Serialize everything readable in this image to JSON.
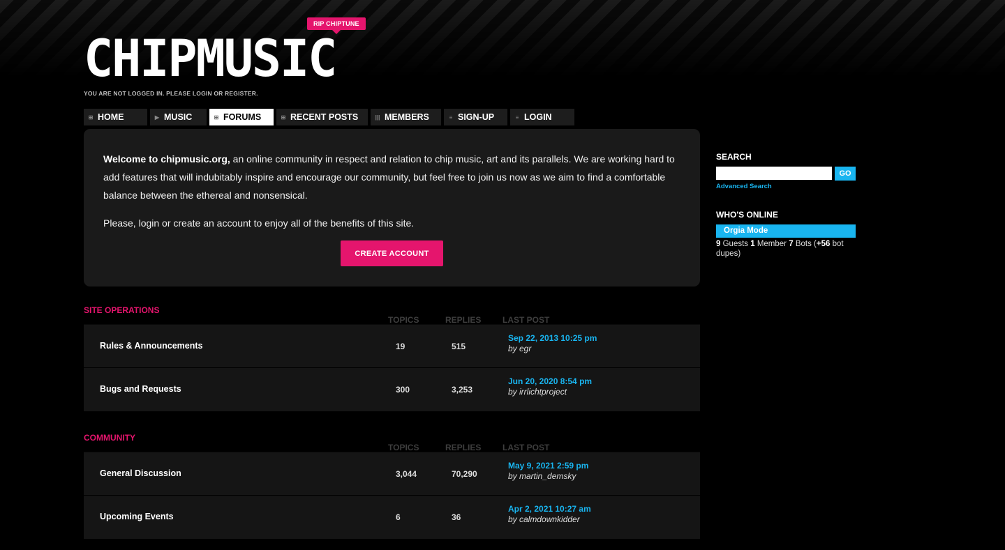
{
  "header": {
    "logo_text": "CHIPMUSIC",
    "rip_badge": "RIP CHIPTUNE",
    "login_note": "YOU ARE NOT LOGGED IN. PLEASE LOGIN OR REGISTER."
  },
  "nav": [
    {
      "label": "HOME",
      "icon": "grid-icon",
      "glyph": "⊞",
      "active": false
    },
    {
      "label": "MUSIC",
      "icon": "play-icon",
      "glyph": "▶",
      "active": false
    },
    {
      "label": "FORUMS",
      "icon": "grid-icon",
      "glyph": "⊞",
      "active": true
    },
    {
      "label": "RECENT POSTS",
      "icon": "grid-icon",
      "glyph": "⊞",
      "active": false
    },
    {
      "label": "MEMBERS",
      "icon": "bars-icon",
      "glyph": "|||",
      "active": false
    },
    {
      "label": "SIGN-UP",
      "icon": "list-icon",
      "glyph": "≡",
      "active": false
    },
    {
      "label": "LOGIN",
      "icon": "list-icon",
      "glyph": "≡",
      "active": false
    }
  ],
  "welcome": {
    "bold_intro": "Welcome to chipmusic.org,",
    "intro_rest": " an online community in respect and relation to chip music, art and its parallels. We are working hard to add features that will indubitably inspire and encourage our community, but feel free to join us now as we aim to find a comfortable balance between the ethereal and nonsensical.",
    "second": "Please, login or create an account to enjoy all of the benefits of this site.",
    "button": "CREATE ACCOUNT"
  },
  "columns": {
    "topics": "TOPICS",
    "replies": "REPLIES",
    "last_post": "LAST POST"
  },
  "sections": [
    {
      "title": "SITE OPERATIONS",
      "forums": [
        {
          "name": "Rules & Announcements",
          "topics": "19",
          "replies": "515",
          "last_date": "Sep 22, 2013 10:25 pm",
          "last_by": "by egr"
        },
        {
          "name": "Bugs and Requests",
          "topics": "300",
          "replies": "3,253",
          "last_date": "Jun 20, 2020 8:54 pm",
          "last_by": "by irrlichtproject"
        }
      ]
    },
    {
      "title": "COMMUNITY",
      "forums": [
        {
          "name": "General Discussion",
          "topics": "3,044",
          "replies": "70,290",
          "last_date": "May 9, 2021 2:59 pm",
          "last_by": "by martin_demsky"
        },
        {
          "name": "Upcoming Events",
          "topics": "6",
          "replies": "36",
          "last_date": "Apr 2, 2021 10:27 am",
          "last_by": "by calmdownkidder"
        }
      ]
    }
  ],
  "sidebar": {
    "search_title": "SEARCH",
    "search_value": "",
    "go_label": "GO",
    "advanced": "Advanced Search",
    "online_title": "WHO'S ONLINE",
    "online_user": "Orgia Mode",
    "guests_n": "9",
    "guests_label": " Guests ",
    "members_n": "1",
    "members_label": " Member ",
    "bots_n": "7",
    "bots_label": " Bots (",
    "dupes_n": "+56",
    "dupes_label": " bot dupes)"
  },
  "colors": {
    "accent_pink": "#e5156d",
    "accent_blue": "#19b5f0"
  }
}
